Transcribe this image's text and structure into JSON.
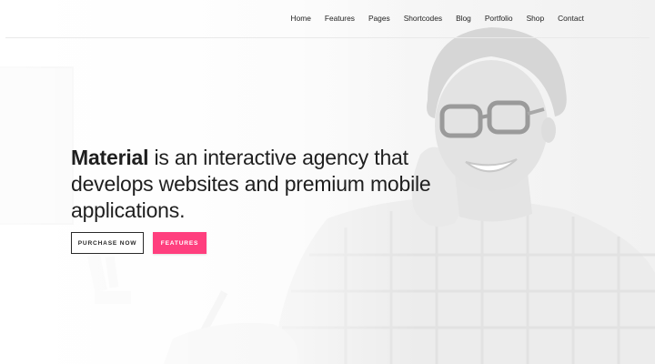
{
  "nav": {
    "items": [
      "Home",
      "Features",
      "Pages",
      "Shortcodes",
      "Blog",
      "Portfolio",
      "Shop",
      "Contact"
    ]
  },
  "hero": {
    "headline_brand": "Material",
    "headline_rest": " is an interactive agency that develops websites and premium mobile applications.",
    "purchase_label": "PURCHASE NOW",
    "features_label": "FEATURES"
  },
  "colors": {
    "accent": "#ff3f7e",
    "text": "#1f1f1f"
  }
}
